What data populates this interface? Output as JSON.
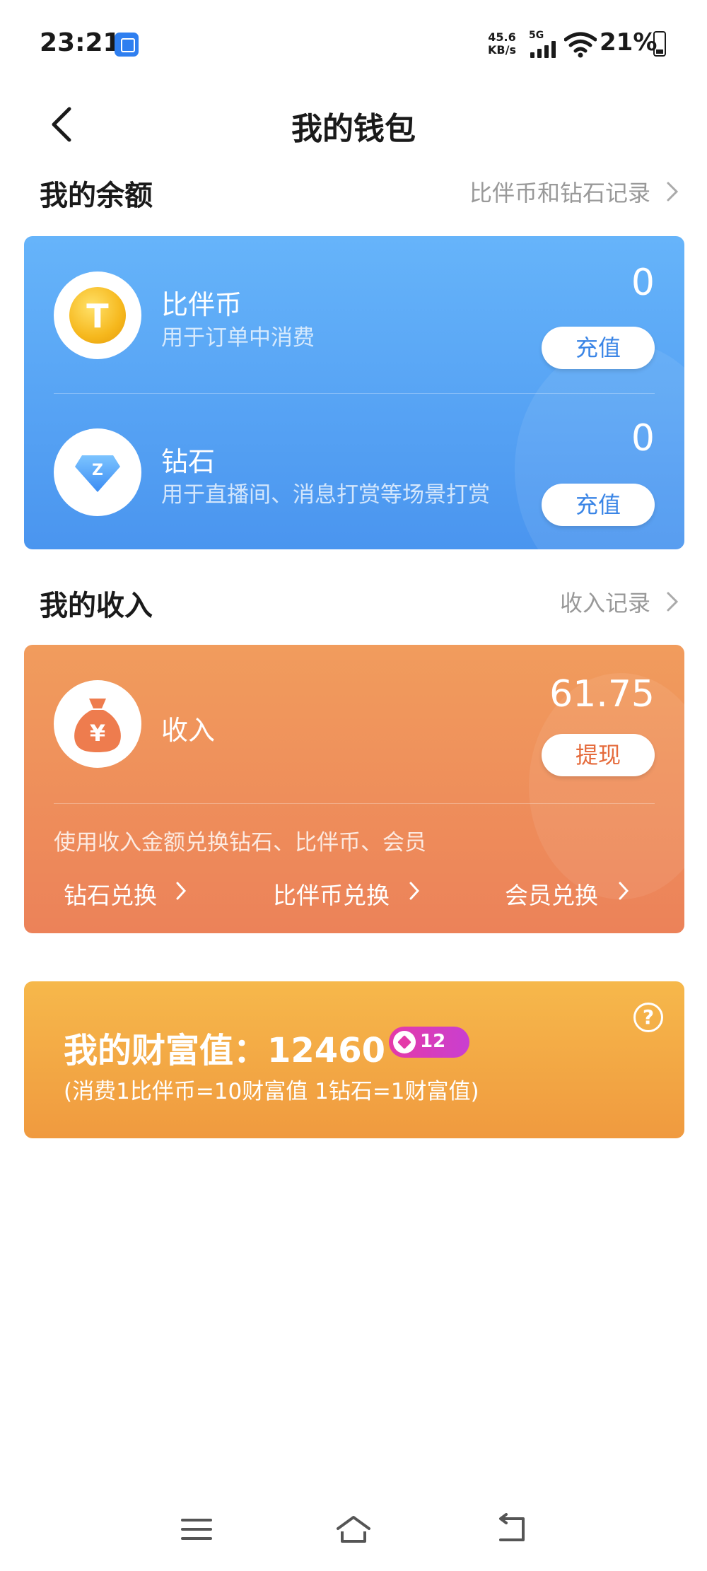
{
  "status_bar": {
    "time": "23:21",
    "net_speed_value": "45.6",
    "net_speed_unit": "KB/s",
    "network": "5G",
    "battery": "21%"
  },
  "header": {
    "title": "我的钱包",
    "back_icon": "chevron-left-icon"
  },
  "balance": {
    "section_title": "我的余额",
    "records_link": "比伴币和钻石记录",
    "items": [
      {
        "name": "比伴币",
        "desc": "用于订单中消费",
        "value": "0",
        "button": "充值",
        "icon": "coin-icon",
        "icon_letter": "T"
      },
      {
        "name": "钻石",
        "desc": "用于直播间、消息打赏等场景打赏",
        "value": "0",
        "button": "充值",
        "icon": "diamond-icon",
        "icon_letter": "Z"
      }
    ]
  },
  "income": {
    "section_title": "我的收入",
    "records_link": "收入记录",
    "label": "收入",
    "value": "61.75",
    "button": "提现",
    "hint": "使用收入金额兑换钻石、比伴币、会员",
    "exchanges": [
      "钻石兑换",
      "比伴币兑换",
      "会员兑换"
    ],
    "icon": "money-bag-icon",
    "icon_symbol": "¥"
  },
  "wealth": {
    "title": "我的财富值：12460",
    "level": "12",
    "rule": "(消费1比伴币=10财富值 1钻石=1财富值)",
    "help_icon": "?"
  },
  "colors": {
    "balance_card": "#5aa5f5",
    "income_card": "#ee8a5a",
    "wealth_card": "#f3a844",
    "accent_blue": "#3a85e6",
    "accent_orange": "#e56b3c"
  }
}
